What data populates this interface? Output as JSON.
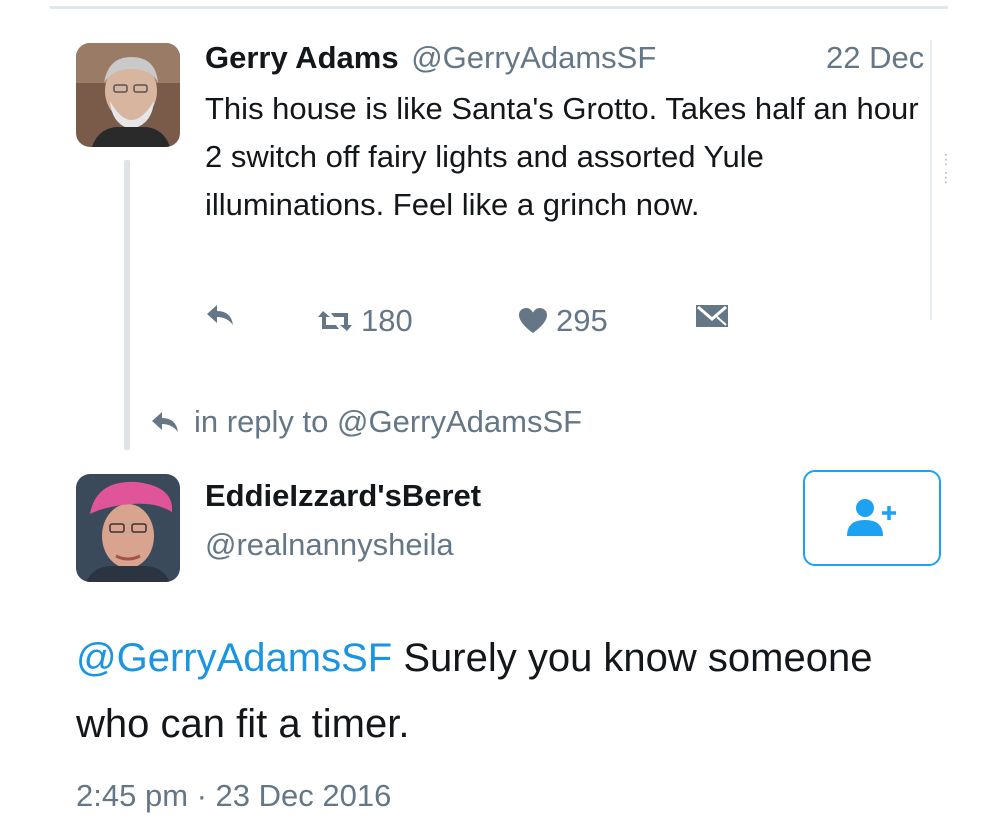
{
  "tweet1": {
    "author_name": "Gerry Adams",
    "author_handle": "@GerryAdamsSF",
    "date": "22 Dec",
    "text": "This house is like Santa's Grotto. Takes half an hour 2 switch off fairy lights and assorted Yule illuminations. Feel like a grinch now.",
    "retweets": "180",
    "likes": "295",
    "icons": [
      "reply-icon",
      "retweet-icon",
      "heart-icon",
      "direct-message-icon"
    ]
  },
  "reply_context": {
    "text": "in reply to @GerryAdamsSF"
  },
  "tweet2": {
    "author_name": "EddieIzzard'sBeret",
    "author_handle": "@realnannysheila",
    "mention": "@GerryAdamsSF",
    "text": " Surely you know someone who can fit a timer.",
    "timestamp": "2:45 pm · 23 Dec 2016",
    "follow_icon": "follow-user-icon"
  },
  "colors": {
    "link": "#1b95e0",
    "muted": "#657786",
    "text": "#14171a",
    "accent": "#1da1f2"
  }
}
